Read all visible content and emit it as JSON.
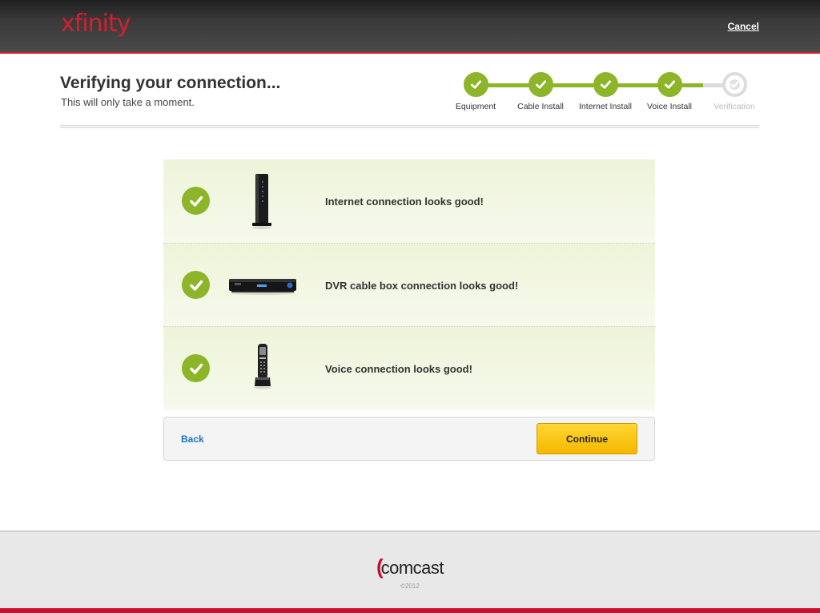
{
  "header": {
    "logo": "xfinity",
    "cancel_label": "Cancel"
  },
  "page": {
    "title": "Verifying your connection...",
    "subtitle": "This will only take a moment."
  },
  "progress": {
    "steps": [
      {
        "label": "Equipment",
        "complete": true
      },
      {
        "label": "Cable Install",
        "complete": true
      },
      {
        "label": "Internet Install",
        "complete": true
      },
      {
        "label": "Voice Install",
        "complete": true
      },
      {
        "label": "Verification",
        "complete": false
      }
    ]
  },
  "status_rows": [
    {
      "device_icon": "modem-icon",
      "message": "Internet connection looks good!"
    },
    {
      "device_icon": "cable-box-icon",
      "message": "DVR cable box connection looks good!"
    },
    {
      "device_icon": "cordless-phone-icon",
      "message": "Voice connection looks good!"
    }
  ],
  "actions": {
    "back_label": "Back",
    "continue_label": "Continue"
  },
  "footer": {
    "brand": "comcast",
    "copyright": "©2012"
  },
  "colors": {
    "brand_red": "#d2202f",
    "check_green": "#8db52a",
    "continue_yellow": "#f5b800",
    "link_blue": "#1a73c4"
  }
}
